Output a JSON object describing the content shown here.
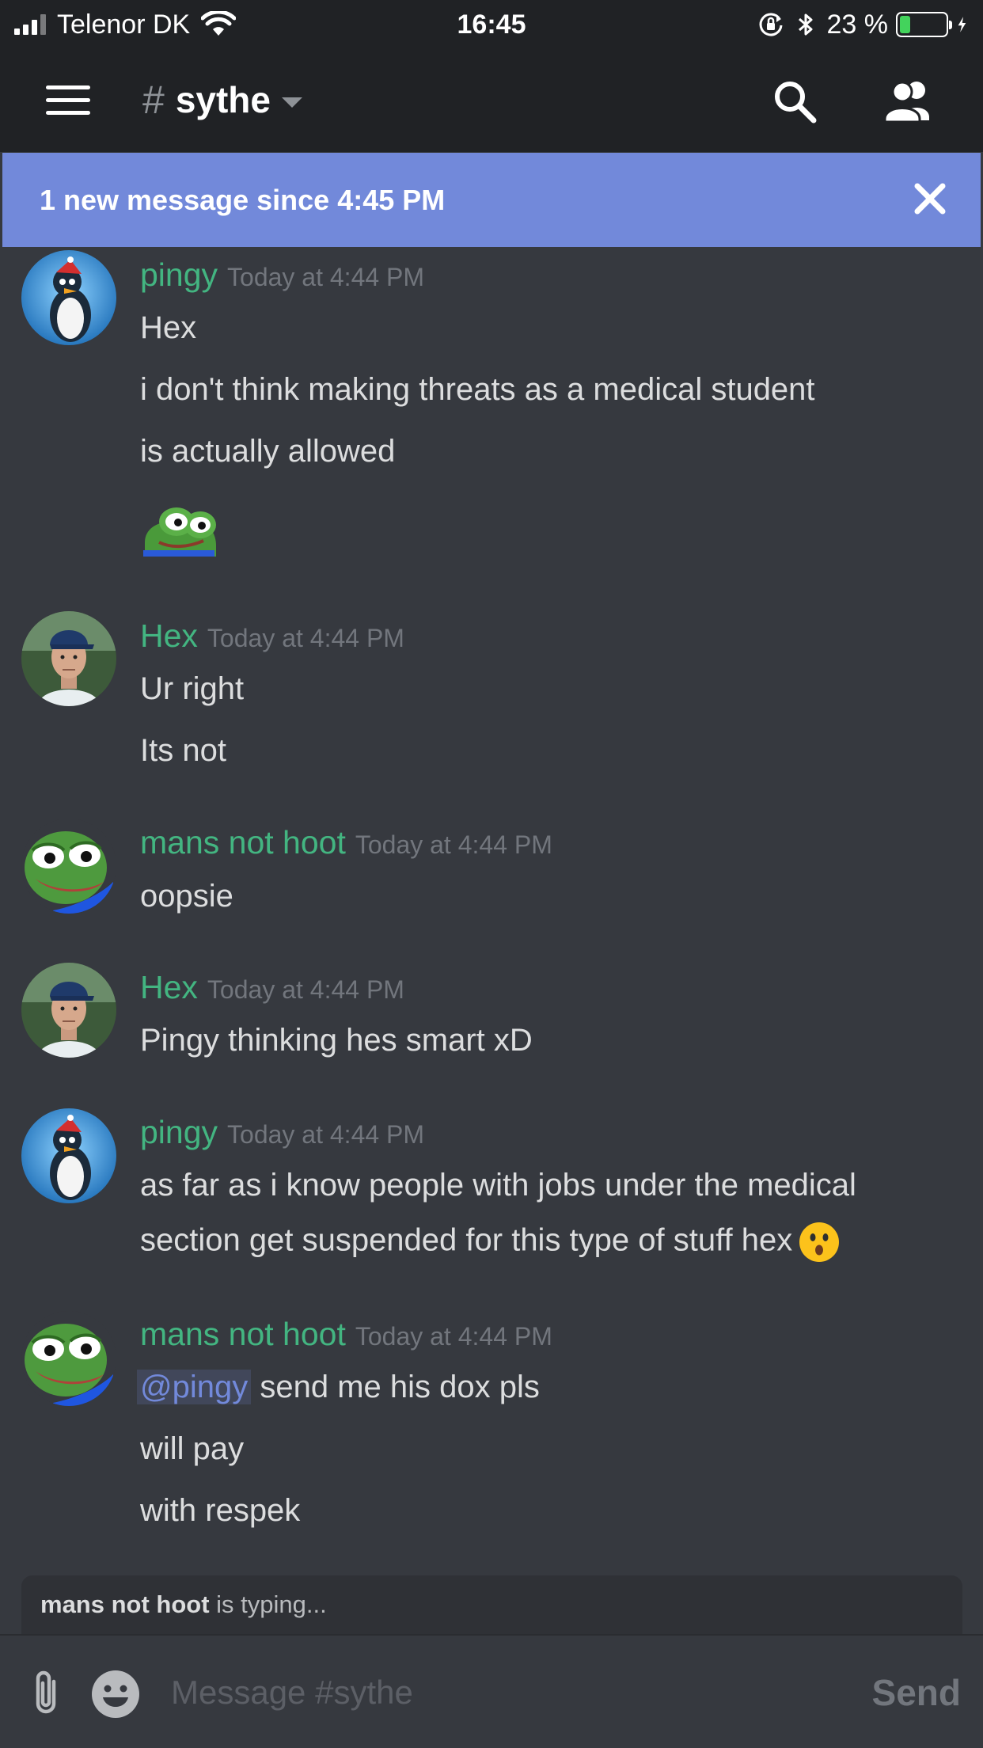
{
  "status_bar": {
    "carrier": "Telenor DK",
    "time": "16:45",
    "battery_percent": "23 %",
    "battery_level": 0.23,
    "battery_color": "#43d35c"
  },
  "header": {
    "hash": "#",
    "channel_name": "sythe"
  },
  "banner": {
    "text": "1 new message since 4:45 PM",
    "color": "#7289da"
  },
  "colors": {
    "username": "#43b581",
    "timestamp": "#72767d",
    "mention": "#7289da"
  },
  "messages": [
    {
      "author": "pingy",
      "timestamp": "Today at 4:44 PM",
      "avatar": "penguin-avatar",
      "lines": [
        "Hex",
        "i don't think making threats as a medical student",
        "is actually allowed"
      ],
      "attachment": "pepe-sticker"
    },
    {
      "author": "Hex",
      "timestamp": "Today at 4:44 PM",
      "avatar": "man-cap-avatar",
      "lines": [
        "Ur right",
        "Its not"
      ]
    },
    {
      "author": "mans not hoot",
      "timestamp": "Today at 4:44 PM",
      "avatar": "pepe-avatar",
      "lines": [
        "oopsie"
      ]
    },
    {
      "author": "Hex",
      "timestamp": "Today at 4:44 PM",
      "avatar": "man-cap-avatar",
      "lines": [
        "Pingy thinking hes smart xD"
      ]
    },
    {
      "author": "pingy",
      "timestamp": "Today at 4:44 PM",
      "avatar": "penguin-avatar",
      "lines": [
        "as far as i know people with jobs under the medical",
        "section get suspended for this type of stuff hex"
      ],
      "emoji": "hushed-face"
    },
    {
      "author": "mans not hoot",
      "timestamp": "Today at 4:44 PM",
      "avatar": "pepe-avatar",
      "mention": "@pingy",
      "lines": [
        " send me his dox pls",
        "will pay",
        "with respek"
      ]
    }
  ],
  "typing": {
    "user": "mans not hoot",
    "text": " is typing..."
  },
  "composer": {
    "placeholder": "Message #sythe",
    "send_label": "Send"
  }
}
